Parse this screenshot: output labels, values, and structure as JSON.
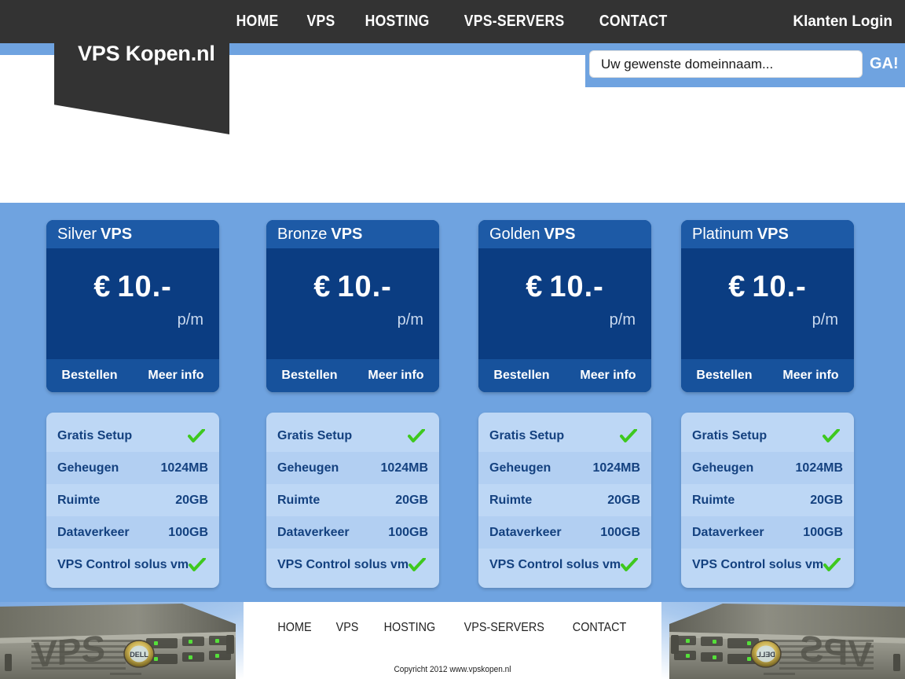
{
  "site": {
    "logo_text": "VPS Kopen.nl",
    "accent_blue": "#6fa3e0",
    "dark": "#333333",
    "card_navy": "#0b3d82",
    "card_head_blue": "#1d5aa6",
    "spec_blue": "#bdd7f5",
    "check_green": "#3ec81e"
  },
  "nav": {
    "items": [
      {
        "label": "HOME"
      },
      {
        "label": "VPS"
      },
      {
        "label": "HOSTING"
      },
      {
        "label": "VPS-SERVERS"
      },
      {
        "label": "CONTACT"
      }
    ],
    "login_label": "Klanten Login"
  },
  "search": {
    "value": "",
    "placeholder": "Uw gewenste domeinnaam...",
    "button_label": "GA!"
  },
  "plans": [
    {
      "tier": "Silver",
      "suffix": "VPS",
      "currency": "€",
      "price": "10.-",
      "period": "p/m",
      "order_label": "Bestellen",
      "info_label": "Meer info",
      "specs": [
        {
          "label": "Gratis Setup",
          "value": "",
          "check": true
        },
        {
          "label": "Geheugen",
          "value": "1024MB",
          "check": false
        },
        {
          "label": "Ruimte",
          "value": "20GB",
          "check": false
        },
        {
          "label": "Dataverkeer",
          "value": "100GB",
          "check": false
        },
        {
          "label": "VPS Control solus vm",
          "value": "",
          "check": true
        }
      ]
    },
    {
      "tier": "Bronze",
      "suffix": "VPS",
      "currency": "€",
      "price": "10.-",
      "period": "p/m",
      "order_label": "Bestellen",
      "info_label": "Meer info",
      "specs": [
        {
          "label": "Gratis Setup",
          "value": "",
          "check": true
        },
        {
          "label": "Geheugen",
          "value": "1024MB",
          "check": false
        },
        {
          "label": "Ruimte",
          "value": "20GB",
          "check": false
        },
        {
          "label": "Dataverkeer",
          "value": "100GB",
          "check": false
        },
        {
          "label": "VPS Control solus vm",
          "value": "",
          "check": true
        }
      ]
    },
    {
      "tier": "Golden",
      "suffix": "VPS",
      "currency": "€",
      "price": "10.-",
      "period": "p/m",
      "order_label": "Bestellen",
      "info_label": "Meer info",
      "specs": [
        {
          "label": "Gratis Setup",
          "value": "",
          "check": true
        },
        {
          "label": "Geheugen",
          "value": "1024MB",
          "check": false
        },
        {
          "label": "Ruimte",
          "value": "20GB",
          "check": false
        },
        {
          "label": "Dataverkeer",
          "value": "100GB",
          "check": false
        },
        {
          "label": "VPS Control solus vm",
          "value": "",
          "check": true
        }
      ]
    },
    {
      "tier": "Platinum",
      "suffix": "VPS",
      "currency": "€",
      "price": "10.-",
      "period": "p/m",
      "order_label": "Bestellen",
      "info_label": "Meer info",
      "specs": [
        {
          "label": "Gratis Setup",
          "value": "",
          "check": true
        },
        {
          "label": "Geheugen",
          "value": "1024MB",
          "check": false
        },
        {
          "label": "Ruimte",
          "value": "20GB",
          "check": false
        },
        {
          "label": "Dataverkeer",
          "value": "100GB",
          "check": false
        },
        {
          "label": "VPS Control solus vm",
          "value": "",
          "check": true
        }
      ]
    }
  ],
  "footer": {
    "nav": [
      {
        "label": "HOME"
      },
      {
        "label": "VPS"
      },
      {
        "label": "HOSTING"
      },
      {
        "label": "VPS-SERVERS"
      },
      {
        "label": "CONTACT"
      }
    ],
    "copyright": "Copyricht 2012  www.vpskopen.nl",
    "server_image_text": "VPS",
    "server_brand": "DELL"
  }
}
